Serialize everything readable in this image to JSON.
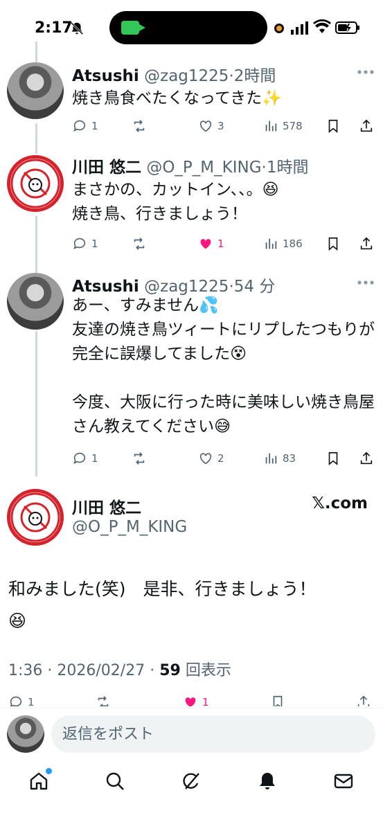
{
  "status_bar": {
    "time": "2:17"
  },
  "tweets": [
    {
      "name": "Atsushi",
      "handle": "@zag1225",
      "time": "2時間",
      "text": "焼き鳥食べたくなってきた✨",
      "replies": "1",
      "likes": "3",
      "views": "578",
      "liked": false
    },
    {
      "name": "川田 悠二",
      "handle": "@O_P_M_KING",
      "time": "1時間",
      "text": "まさかの、カットイン、、。😆\n焼き鳥、行きましょう！",
      "replies": "1",
      "likes": "1",
      "views": "186",
      "liked": true
    },
    {
      "name": "Atsushi",
      "handle": "@zag1225",
      "time": "54 分",
      "text": "あー、すみません💦\n友達の焼き鳥ツィートにリプしたつもりが完全に誤爆してました😵\n\n今度、大阪に行った時に美味しい焼き鳥屋さん教えてください😅",
      "replies": "1",
      "likes": "2",
      "views": "83",
      "liked": false
    }
  ],
  "main_tweet": {
    "name": "川田 悠二",
    "handle": "@O_P_M_KING",
    "source": "𝕏.com",
    "text": "和みました(笑)　是非、行きましょう！\n😆",
    "time": "1:36",
    "date": "2026/02/27",
    "views": "59",
    "views_label": "回表示",
    "replies": "1",
    "likes": "1"
  },
  "reply_bar": {
    "placeholder": "返信をポスト"
  },
  "tabs": [
    "home",
    "search",
    "grok",
    "notifications",
    "messages"
  ],
  "colors": {
    "like": "#f91880",
    "accent": "#1d9bf0",
    "muted": "#536471",
    "logo_red": "#d6222a"
  }
}
